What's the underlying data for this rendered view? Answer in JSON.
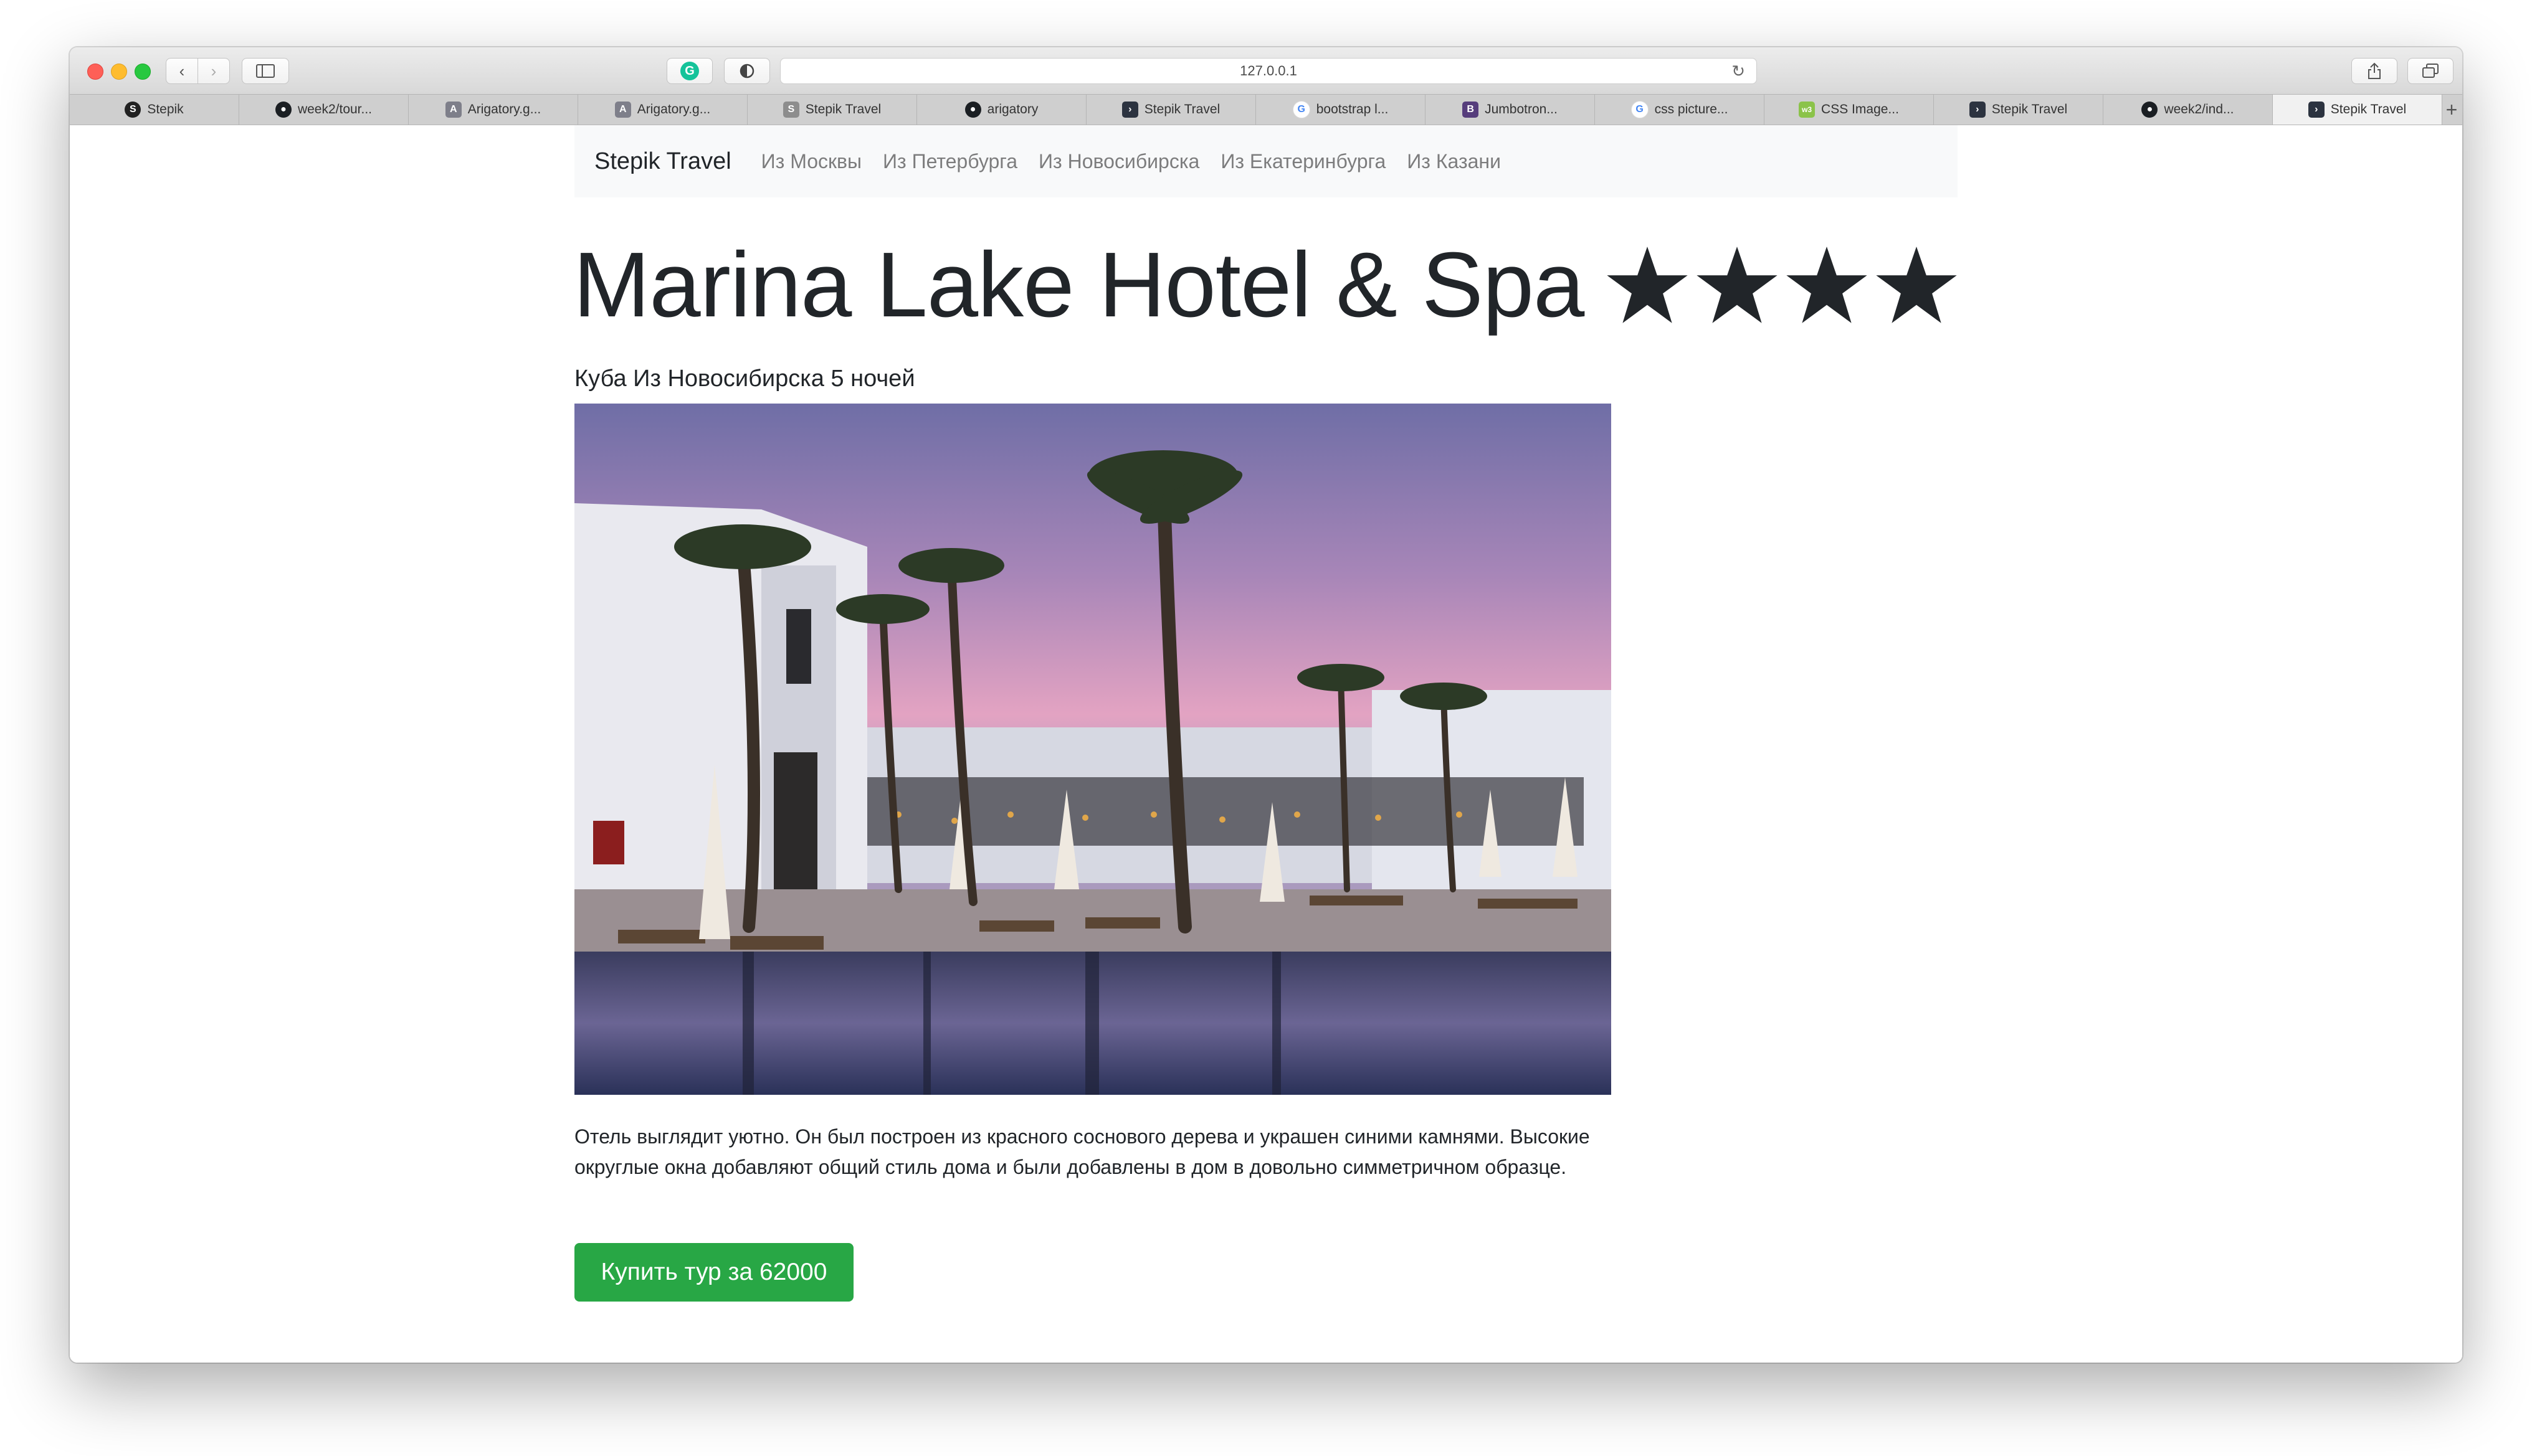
{
  "browser": {
    "url": "127.0.0.1",
    "tabs": [
      {
        "label": "Stepik",
        "icon": "stepik-icon"
      },
      {
        "label": "week2/tour...",
        "icon": "github-icon"
      },
      {
        "label": "Arigatory.g...",
        "icon": "letter-a-icon"
      },
      {
        "label": "Arigatory.g...",
        "icon": "letter-a-icon"
      },
      {
        "label": "Stepik Travel",
        "icon": "letter-s-icon"
      },
      {
        "label": "arigatory",
        "icon": "github-icon"
      },
      {
        "label": "Stepik Travel",
        "icon": "terminal-icon"
      },
      {
        "label": "bootstrap l...",
        "icon": "google-icon"
      },
      {
        "label": "Jumbotron...",
        "icon": "bootstrap-icon"
      },
      {
        "label": "css picture...",
        "icon": "google-icon"
      },
      {
        "label": "CSS Image...",
        "icon": "w3schools-icon"
      },
      {
        "label": "Stepik Travel",
        "icon": "terminal-icon"
      },
      {
        "label": "week2/ind...",
        "icon": "github-icon"
      },
      {
        "label": "Stepik Travel",
        "icon": "terminal-icon"
      }
    ],
    "active_tab": 13
  },
  "navbar": {
    "brand": "Stepik Travel",
    "links": [
      "Из Москвы",
      "Из Петербурга",
      "Из Новосибирска",
      "Из Екатеринбурга",
      "Из Казани"
    ]
  },
  "hotel": {
    "name": "Marina Lake Hotel & Spa",
    "stars": 4,
    "subtitle": "Куба Из Новосибирска 5 ночей",
    "description": "Отель выглядит уютно. Он был построен из красного соснового дерева и украшен синими камнями. Высокие округлые окна добавляют общий стиль дома и были добавлены в дом в довольно симметричном образце.",
    "buy_label": "Купить тур за 62000"
  },
  "colors": {
    "button_green": "#28a745",
    "navbar_bg": "#f8f9fa",
    "text": "#212529"
  }
}
